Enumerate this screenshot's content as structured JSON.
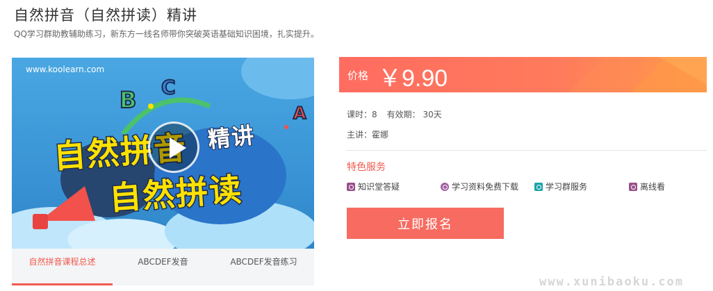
{
  "course": {
    "title": "自然拼音（自然拼读）精讲",
    "subtitle": "QQ学习群助教辅助练习，新东方一线名师带你突破英语基础知识困境，扎实提升。"
  },
  "cover": {
    "site": "www.koolearn.com",
    "text_line1": "自然拼音",
    "text_line2": "自然拼读",
    "text_tag": "精讲",
    "letters": [
      "B",
      "C",
      "A"
    ]
  },
  "tabs": [
    {
      "label": "自然拼音课程总述",
      "active": true
    },
    {
      "label": "ABCDEF发音",
      "active": false
    },
    {
      "label": "ABCDEF发音练习",
      "active": false
    }
  ],
  "price": {
    "label": "价格",
    "value": "￥9.90"
  },
  "meta": {
    "lessons": "课时：8",
    "validity": "有效期：  30天",
    "teacher": "主讲：霍娜"
  },
  "services": {
    "title": "特色服务",
    "items": [
      {
        "label": "知识堂答疑",
        "icon": "qa-icon",
        "color": "#9b4f8c"
      },
      {
        "label": "学习资料免费下载",
        "icon": "download-icon",
        "color": "#a25fa0"
      },
      {
        "label": "学习群服务",
        "icon": "group-icon",
        "color": "#1aa3a8"
      },
      {
        "label": "离线看",
        "icon": "offline-icon",
        "color": "#9b4f8c"
      }
    ]
  },
  "enroll_label": "立即报名",
  "watermark": "www.xunibaoku.com",
  "colors": {
    "accent": "#f05a4e",
    "button": "#f76b61",
    "price_bar": "#ff6c60"
  }
}
